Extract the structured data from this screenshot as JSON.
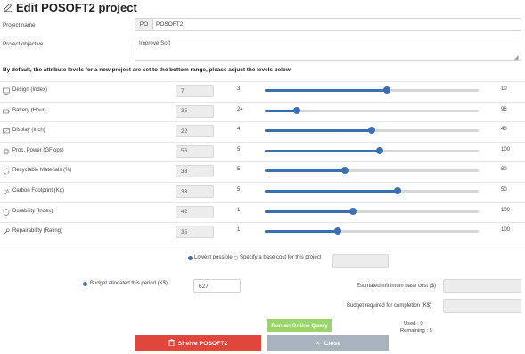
{
  "header": {
    "title": "Edit POSOFT2 project",
    "icon": "edit-icon"
  },
  "form": {
    "project_name_label": "Project name",
    "project_prefix": "PO",
    "project_name_value": "POSOFT2",
    "objective_label": "Project objective",
    "objective_value": "Improve Soft",
    "note": "By default, the attribute levels for a new project are set to the bottom range, please adjust the levels below."
  },
  "attributes": [
    {
      "name": "Design (Index)",
      "value": "7",
      "min": "3",
      "max": "10",
      "level": 0.57,
      "icon": "design-icon"
    },
    {
      "name": "Battery (Hour)",
      "value": "35",
      "min": "24",
      "max": "96",
      "level": 0.15,
      "icon": "battery-icon"
    },
    {
      "name": "Display (Inch)",
      "value": "22",
      "min": "4",
      "max": "40",
      "level": 0.5,
      "icon": "display-icon"
    },
    {
      "name": "Proc. Power (GFlops)",
      "value": "56",
      "min": "5",
      "max": "100",
      "level": 0.537,
      "icon": "processor-icon"
    },
    {
      "name": "Recyclable Materials (%)",
      "value": "33",
      "min": "5",
      "max": "80",
      "level": 0.373,
      "icon": "recycle-icon"
    },
    {
      "name": "Carbon Footprint (Kg)",
      "value": "33",
      "min": "5",
      "max": "50",
      "level": 0.622,
      "icon": "footprint-icon"
    },
    {
      "name": "Durability (Index)",
      "value": "42",
      "min": "1",
      "max": "100",
      "level": 0.414,
      "icon": "shield-icon"
    },
    {
      "name": "Repairability (Rating)",
      "value": "35",
      "min": "1",
      "max": "100",
      "level": 0.343,
      "icon": "wrench-icon"
    }
  ],
  "cost": {
    "option_lowest": "Lowest possible",
    "option_specify": "Specify a base cost for this project",
    "selected_option": "lowest",
    "base_cost_value": ""
  },
  "budget": {
    "allocated_label": "Budget allocated this period (K$)",
    "allocated_value": "627",
    "min_base_cost_label": "Estimated minimum base cost ($)",
    "min_base_cost_value": "",
    "required_label": "Budget required for completion (K$)",
    "required_value": ""
  },
  "query": {
    "button_label": "Run an Online Query",
    "used": "Used : 0",
    "remaining": "Remaining : 5"
  },
  "actions": {
    "shelve_label": "Shelve POSOFT2",
    "close_label": "Close"
  },
  "colors": {
    "accent": "#3a6fb3",
    "shelve": "#e0463a",
    "close": "#a9b3bd",
    "query": "#9bd46a"
  }
}
